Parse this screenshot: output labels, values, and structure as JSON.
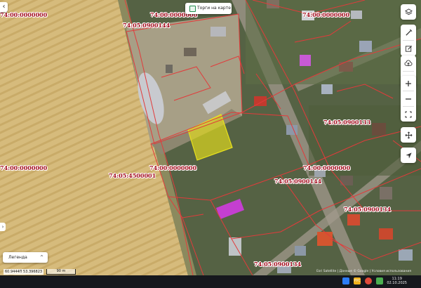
{
  "map": {
    "parcel_labels": [
      "74:00:0000000",
      "74:05:0900144",
      "74:00:0000000",
      "74:05:0900133",
      "74:00:0000000",
      "74:05:4500001",
      "74:00:0000000",
      "74:00:0000000",
      "74:05:0900144",
      "74:05:0900134",
      "74:05:0900134"
    ],
    "colors": {
      "boundary": "#e23b3b",
      "selected_fill": "#e8e11c",
      "zone_fill": "#c43fd0",
      "label_text": "#a30d1e"
    }
  },
  "controls": {
    "back_icon": "chevron-left-icon",
    "left_edge_icon": "chevron-right-icon",
    "top_chip_label": "Торги на карте",
    "toolbar_icons": [
      "layers-icon",
      "ruler-icon",
      "edit-icon",
      "upload-icon",
      "share-icon",
      "zoom-in-icon",
      "zoom-out-icon",
      "fullscreen-icon",
      "move-icon",
      "locate-icon"
    ]
  },
  "legend": {
    "label": "Легенда",
    "chevron": "^"
  },
  "status": {
    "coordinates": "60.9444П  53.396823",
    "scale": "90 m",
    "attribution": "Esri Satellite | Данные © Google | Условия использования"
  },
  "taskbar": {
    "language": "РУС",
    "time": "11:19",
    "date": "02.10.2025"
  }
}
